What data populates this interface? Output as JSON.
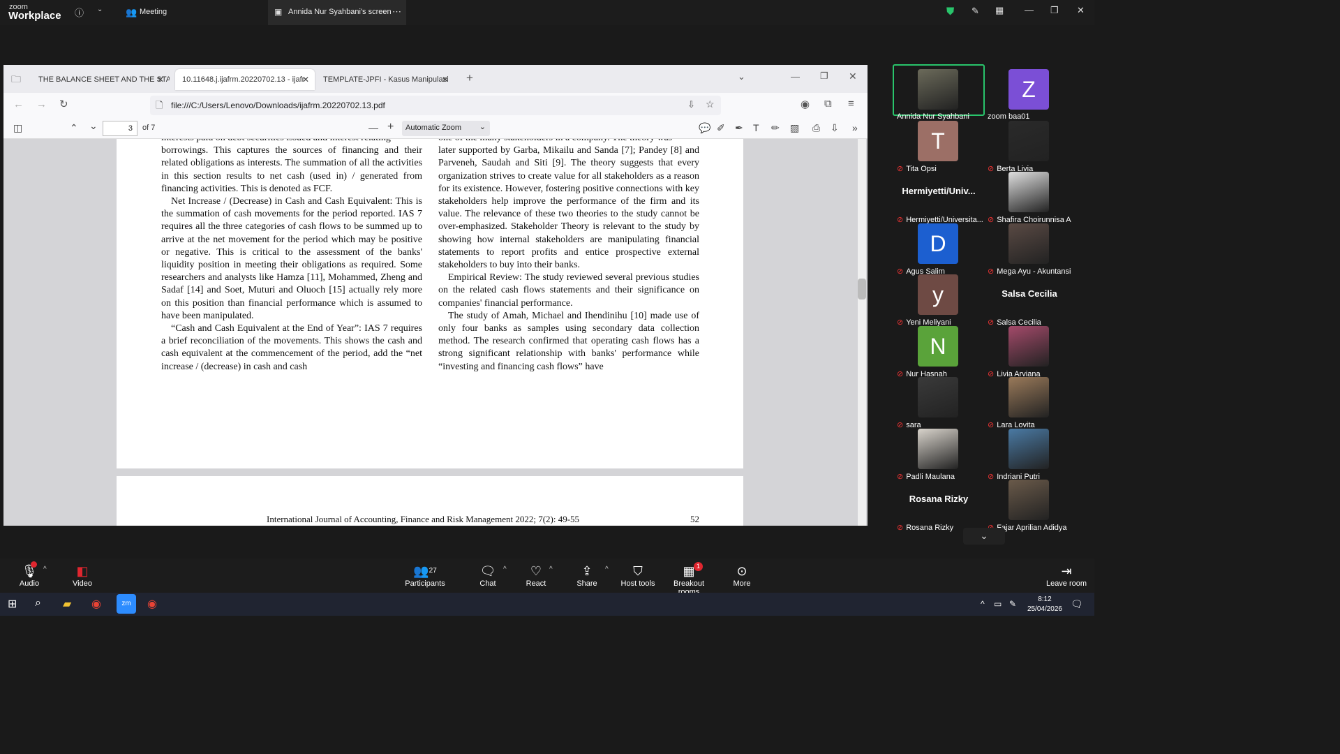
{
  "zoom": {
    "logo_top": "zoom",
    "logo_bottom": "Workplace",
    "meeting_label": "Meeting",
    "screen_tab_label": "Annida Nur Syahbani's screen"
  },
  "browser": {
    "tabs": [
      {
        "label": "THE BALANCE SHEET AND THE STA"
      },
      {
        "label": "10.11648.j.ijafrm.20220702.13 - ijafr"
      },
      {
        "label": "TEMPLATE-JPFI - Kasus Manipulasi"
      }
    ],
    "url": "file:///C:/Users/Lenovo/Downloads/ijafrm.20220702.13.pdf",
    "pdf_toolbar": {
      "page_number": "3",
      "page_total": "of 7",
      "zoom_level": "Automatic Zoom"
    }
  },
  "document": {
    "left_column": [
      "interests paid on debt securities issued and interest relating",
      "borrowings. This captures the sources of financing and their related obligations as interests. The summation of all the activities in this section results to net cash (used in) / generated from financing activities. This is denoted as FCF.",
      "Net Increase / (Decrease) in Cash and Cash Equivalent: This is the summation of cash movements for the period reported. IAS 7 requires all the three categories of cash flows to be summed up to arrive at the net movement for the period which may be positive or negative. This is critical to the assessment of the banks' liquidity position in meeting their obligations as required. Some researchers and analysts like Hamza [11], Mohammed, Zheng and Sadaf [14] and Soet, Muturi and Oluoch [15] actually rely more on this position than financial performance which is assumed to have been manipulated.",
      "“Cash and Cash Equivalent at the End of Year”: IAS 7 requires a brief reconciliation of the movements. This shows the cash and cash equivalent at the commencement of the period, add the “net increase / (decrease) in cash and cash"
    ],
    "right_column": [
      "one of the many stakeholders in a company. The theory was",
      "later supported by Garba, Mikailu and Sanda [7]; Pandey [8] and Parveneh, Saudah and Siti [9]. The theory suggests that every organization strives to create value for all stakeholders as a reason for its existence. However, fostering positive connections with key stakeholders help improve the performance of the firm and its value. The relevance of these two theories to the study cannot be over-emphasized. Stakeholder Theory is relevant to the study by showing how internal stakeholders are manipulating financial statements to report profits and entice prospective external stakeholders to buy into their banks.",
      "Empirical Review: The study reviewed several previous studies on the related cash flows statements and their significance on companies' financial performance.",
      "The study of Amah, Michael and Ihendinihu [10] made use of only four banks as samples using secondary data collection method. The research confirmed that operating cash flows has a strong significant relationship with banks' performance while “investing and financing cash flows” have"
    ],
    "footer_journal": "International Journal of Accounting, Finance and Risk Management 2022; 7(2): 49-55",
    "footer_page": "52"
  },
  "participants": [
    {
      "name": "Annida Nur Syahbani",
      "type": "photo",
      "color": "#6b6a5a",
      "big": ""
    },
    {
      "name": "zoom baa01",
      "type": "letter",
      "letter": "Z",
      "color": "#7b4fd6",
      "big": ""
    },
    {
      "name": "Tita Opsi",
      "type": "letter",
      "letter": "T",
      "color": "#9c6f66",
      "big": ""
    },
    {
      "name": "Berta Livia",
      "type": "photo",
      "color": "#2a2a2a",
      "big": ""
    },
    {
      "name": "Hermiyetti/Universita...",
      "type": "big",
      "big": "Hermiyetti/Univ..."
    },
    {
      "name": "Shafira Choirunnisa A",
      "type": "photo",
      "color": "#e0e0e0",
      "big": ""
    },
    {
      "name": "Agus Salim",
      "type": "letter",
      "letter": "D",
      "color": "#1c5fd0",
      "big": ""
    },
    {
      "name": "Mega Ayu - Akuntansi",
      "type": "photo",
      "color": "#5a4a44",
      "big": ""
    },
    {
      "name": "Yeni Meliyani",
      "type": "letter",
      "letter": "y",
      "color": "#6e4a44",
      "big": ""
    },
    {
      "name": "Salsa Cecilia",
      "type": "big",
      "big": "Salsa Cecilia"
    },
    {
      "name": "Nur Hasnah",
      "type": "letter",
      "letter": "N",
      "color": "#5aa33a",
      "big": ""
    },
    {
      "name": "Livia Arviana",
      "type": "photo",
      "color": "#a44a6a",
      "big": ""
    },
    {
      "name": "sara",
      "type": "photo",
      "color": "#3a3a3a",
      "big": ""
    },
    {
      "name": "Lara Lovita",
      "type": "photo",
      "color": "#9a7a5a",
      "big": ""
    },
    {
      "name": "Padli Maulana",
      "type": "photo",
      "color": "#d9d4cc",
      "big": ""
    },
    {
      "name": "Indriani Putri",
      "type": "photo",
      "color": "#4a7aa4",
      "big": ""
    },
    {
      "name": "Rosana Rizky",
      "type": "big",
      "big": "Rosana Rizky"
    },
    {
      "name": "Fajar Aprilian Adidya",
      "type": "photo",
      "color": "#6a5a4a",
      "big": ""
    }
  ],
  "toolbar": {
    "audio": "Audio",
    "video": "Video",
    "participants": "Participants",
    "participants_count": "27",
    "chat": "Chat",
    "react": "React",
    "share": "Share",
    "host_tools": "Host tools",
    "breakout_rooms": "Breakout rooms",
    "breakout_badge": "1",
    "more": "More",
    "leave": "Leave room"
  },
  "taskbar": {
    "time": "8:12",
    "date": "25/04/2026"
  },
  "colors": {
    "active_tile_border": "#29c46b",
    "leave_red": "#e0262f",
    "mute_red": "#e33333"
  }
}
